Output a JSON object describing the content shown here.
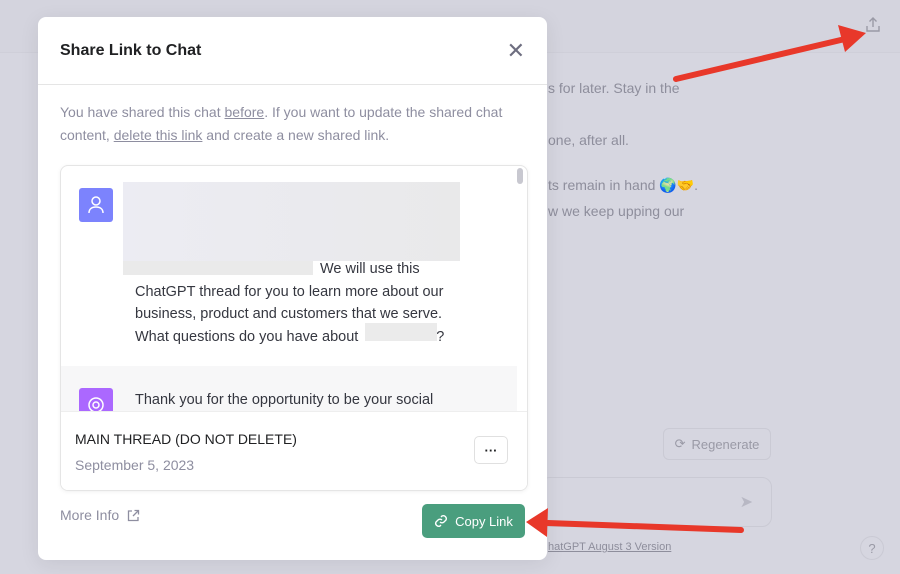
{
  "background": {
    "lines": [
      "s for later. Stay in the",
      "one, after all.",
      "ts remain in hand 🌍🤝.",
      "w we keep upping our"
    ],
    "regenerate_label": "Regenerate",
    "version_link": "hatGPT August 3 Version",
    "help_label": "?"
  },
  "modal": {
    "title": "Share Link to Chat",
    "desc_1": "You have shared this chat ",
    "desc_link_before": "before",
    "desc_2": ". If you want to update the shared chat content, ",
    "desc_link_delete": "delete this link",
    "desc_3": " and create a new shared link.",
    "preview": {
      "user_msg_1": "We will use this",
      "user_msg_2": "ChatGPT thread for you to learn more about our business, product and customers that we serve. What questions do you have about",
      "user_msg_end": "?",
      "gpt_msg": "Thank you for the opportunity to be your social"
    },
    "thread_name": "MAIN THREAD (DO NOT DELETE)",
    "thread_date": "September 5, 2023",
    "more_label": "···",
    "more_info_label": "More Info",
    "copy_link_label": "Copy Link"
  },
  "colors": {
    "accent": "#4a9e7e",
    "user_avatar": "#7c83fd",
    "gpt_avatar": "#ab68ff",
    "annotation_arrow": "#e8382a"
  }
}
